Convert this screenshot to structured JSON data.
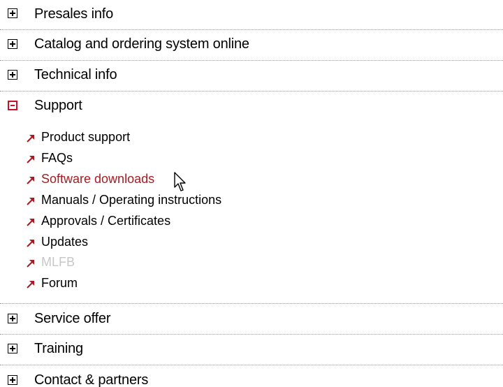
{
  "accordion": {
    "sections": [
      {
        "label": "Presales info",
        "expanded": false
      },
      {
        "label": "Catalog and ordering system online",
        "expanded": false
      },
      {
        "label": "Technical info",
        "expanded": false
      },
      {
        "label": "Support",
        "expanded": true
      },
      {
        "label": "Service offer",
        "expanded": false
      },
      {
        "label": "Training",
        "expanded": false
      },
      {
        "label": "Contact & partners",
        "expanded": false
      }
    ],
    "support_links": [
      {
        "label": "Product support",
        "state": "normal"
      },
      {
        "label": "FAQs",
        "state": "normal"
      },
      {
        "label": "Software downloads",
        "state": "hover"
      },
      {
        "label": "Manuals / Operating instructions",
        "state": "normal"
      },
      {
        "label": "Approvals / Certificates",
        "state": "normal"
      },
      {
        "label": "Updates",
        "state": "normal"
      },
      {
        "label": "MLFB",
        "state": "disabled"
      },
      {
        "label": "Forum",
        "state": "normal"
      }
    ]
  },
  "colors": {
    "accent": "#c8102e",
    "link_hover": "#a51d23",
    "link_arrow": "#a51d23",
    "disabled_text": "#c7c7c7",
    "separator": "#9a9a9a"
  },
  "icons": {
    "collapsed": "plus-square-icon",
    "expanded": "minus-square-icon",
    "link": "north-east-arrow-icon",
    "pointer": "mouse-cursor-icon"
  }
}
